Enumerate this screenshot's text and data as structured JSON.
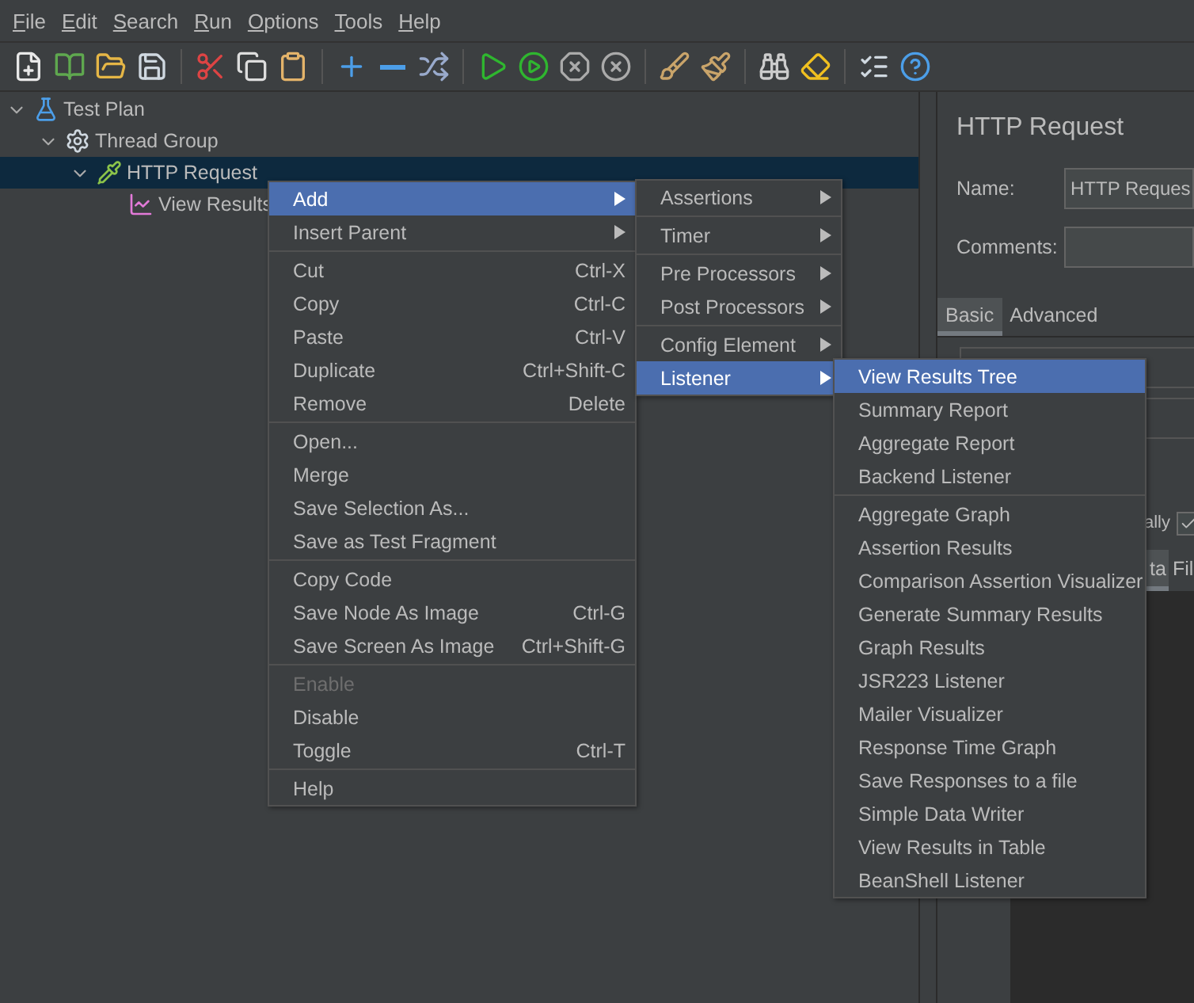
{
  "menubar": [
    {
      "label": "File"
    },
    {
      "label": "Edit"
    },
    {
      "label": "Search"
    },
    {
      "label": "Run"
    },
    {
      "label": "Options"
    },
    {
      "label": "Tools"
    },
    {
      "label": "Help"
    }
  ],
  "tree": [
    {
      "label": "Test Plan",
      "kind": "plan",
      "expanded": true,
      "selected": false,
      "children": [
        {
          "label": "Thread Group",
          "kind": "group",
          "expanded": true,
          "selected": false,
          "children": [
            {
              "label": "HTTP Request",
              "kind": "sampler",
              "expanded": true,
              "selected": true,
              "children": [
                {
                  "label": "View Results",
                  "kind": "listener",
                  "selected": false
                }
              ]
            }
          ]
        }
      ]
    }
  ],
  "editor": {
    "title": "HTTP Request",
    "name_label": "Name:",
    "name_value": "HTTP Reques",
    "comments_label": "Comments:",
    "tabs": [
      {
        "label": "Basic",
        "selected": true
      },
      {
        "label": "Advanced",
        "selected": false
      }
    ],
    "option_fragment": "ally",
    "option_checked": true,
    "lower_tabs": [
      {
        "label": "ta",
        "selected": true
      },
      {
        "label": "Fil",
        "selected": false
      }
    ]
  },
  "context_menu": {
    "groups": [
      [
        {
          "label": "Add",
          "submenu": true,
          "selected": true,
          "disabled": false
        },
        {
          "label": "Insert Parent",
          "submenu": true,
          "selected": false,
          "disabled": false
        }
      ],
      [
        {
          "label": "Cut",
          "shortcut": "Ctrl-X",
          "selected": false,
          "disabled": false
        },
        {
          "label": "Copy",
          "shortcut": "Ctrl-C",
          "selected": false,
          "disabled": false
        },
        {
          "label": "Paste",
          "shortcut": "Ctrl-V",
          "selected": false,
          "disabled": false
        },
        {
          "label": "Duplicate",
          "shortcut": "Ctrl+Shift-C",
          "selected": false,
          "disabled": false
        },
        {
          "label": "Remove",
          "shortcut": "Delete",
          "selected": false,
          "disabled": false
        }
      ],
      [
        {
          "label": "Open...",
          "selected": false,
          "disabled": false
        },
        {
          "label": "Merge",
          "selected": false,
          "disabled": false
        },
        {
          "label": "Save Selection As...",
          "selected": false,
          "disabled": false
        },
        {
          "label": "Save as Test Fragment",
          "selected": false,
          "disabled": false
        }
      ],
      [
        {
          "label": "Copy Code",
          "selected": false,
          "disabled": false
        },
        {
          "label": "Save Node As Image",
          "shortcut": "Ctrl-G",
          "selected": false,
          "disabled": false
        },
        {
          "label": "Save Screen As Image",
          "shortcut": "Ctrl+Shift-G",
          "selected": false,
          "disabled": false
        }
      ],
      [
        {
          "label": "Enable",
          "selected": false,
          "disabled": true
        },
        {
          "label": "Disable",
          "selected": false,
          "disabled": false
        },
        {
          "label": "Toggle",
          "shortcut": "Ctrl-T",
          "selected": false,
          "disabled": false
        }
      ],
      [
        {
          "label": "Help",
          "selected": false,
          "disabled": false
        }
      ]
    ]
  },
  "add_menu": {
    "groups": [
      [
        {
          "label": "Assertions",
          "submenu": true,
          "selected": false
        }
      ],
      [
        {
          "label": "Timer",
          "submenu": true,
          "selected": false
        }
      ],
      [
        {
          "label": "Pre Processors",
          "submenu": true,
          "selected": false
        },
        {
          "label": "Post Processors",
          "submenu": true,
          "selected": false
        }
      ],
      [
        {
          "label": "Config Element",
          "submenu": true,
          "selected": false
        },
        {
          "label": "Listener",
          "submenu": true,
          "selected": true
        }
      ]
    ]
  },
  "listener_menu": {
    "groups": [
      [
        {
          "label": "View Results Tree",
          "selected": true
        },
        {
          "label": "Summary Report",
          "selected": false
        },
        {
          "label": "Aggregate Report",
          "selected": false
        },
        {
          "label": "Backend Listener",
          "selected": false
        }
      ],
      [
        {
          "label": "Aggregate Graph",
          "selected": false
        },
        {
          "label": "Assertion Results",
          "selected": false
        },
        {
          "label": "Comparison Assertion Visualizer",
          "selected": false
        },
        {
          "label": "Generate Summary Results",
          "selected": false
        },
        {
          "label": "Graph Results",
          "selected": false
        },
        {
          "label": "JSR223 Listener",
          "selected": false
        },
        {
          "label": "Mailer Visualizer",
          "selected": false
        },
        {
          "label": "Response Time Graph",
          "selected": false
        },
        {
          "label": "Save Responses to a file",
          "selected": false
        },
        {
          "label": "Simple Data Writer",
          "selected": false
        },
        {
          "label": "View Results in Table",
          "selected": false
        },
        {
          "label": "BeanShell Listener",
          "selected": false
        }
      ]
    ]
  }
}
